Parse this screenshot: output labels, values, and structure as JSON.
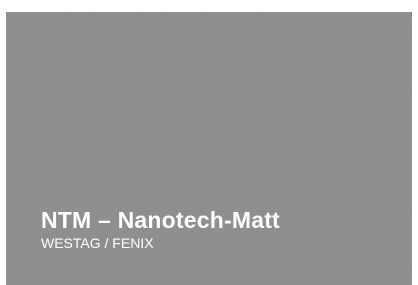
{
  "swatch": {
    "title": "NTM – Nanotech-Matt",
    "subtitle": "WESTAG / FENIX",
    "color": "#8a8b89",
    "text_color": "#ffffff"
  }
}
